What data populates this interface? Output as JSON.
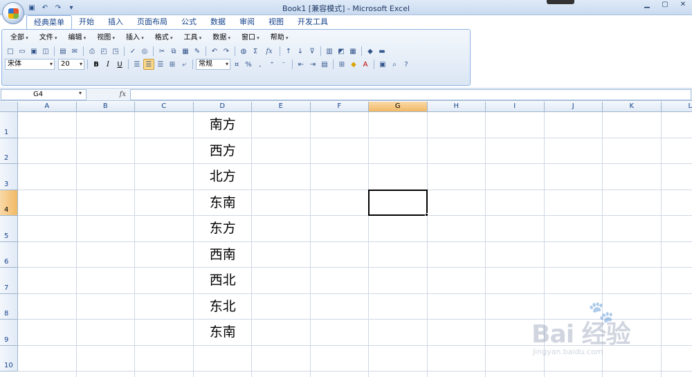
{
  "window": {
    "title": "Book1 [兼容模式] - Microsoft Excel"
  },
  "ribbon_tabs": [
    "经典菜单",
    "开始",
    "插入",
    "页面布局",
    "公式",
    "数据",
    "审阅",
    "视图",
    "开发工具"
  ],
  "classic_menu": [
    "全部",
    "文件",
    "编辑",
    "视图",
    "插入",
    "格式",
    "工具",
    "数据",
    "窗口",
    "帮助"
  ],
  "toolbar": {
    "font_name": "宋体",
    "font_size": "20",
    "bold_label": "B",
    "italic_label": "I",
    "underline_label": "U",
    "number_format": "常规",
    "percent_label": "%",
    "comma_label": ",",
    "sum_label": "Σ",
    "fx_label": "fx"
  },
  "formula_bar": {
    "name_box": "G4",
    "fx_label": "fx",
    "formula": ""
  },
  "columns": [
    "A",
    "B",
    "C",
    "D",
    "E",
    "F",
    "G",
    "H",
    "I",
    "J",
    "K",
    "L"
  ],
  "rows": [
    "1",
    "2",
    "3",
    "4",
    "5",
    "6",
    "7",
    "8",
    "9",
    "10"
  ],
  "column_d_values": [
    "南方",
    "西方",
    "北方",
    "东南",
    "东方",
    "西南",
    "西北",
    "东北",
    "东南"
  ],
  "selection": {
    "cell": "G4",
    "column": "G",
    "row": "4"
  },
  "watermark": {
    "main": "Bai 经验",
    "sub": "jingyan.baidu.com"
  }
}
